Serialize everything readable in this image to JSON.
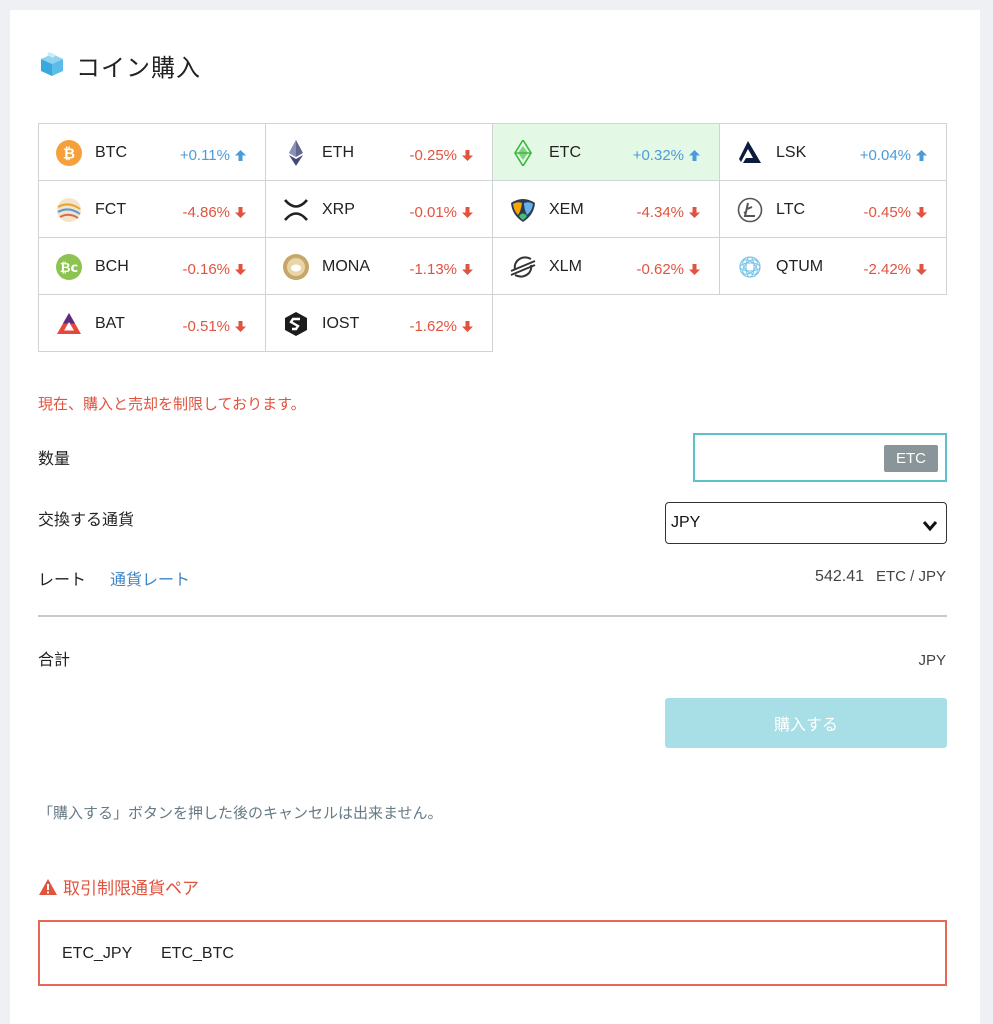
{
  "header": {
    "title": "コイン購入",
    "icon": "cube-icon"
  },
  "coins": [
    {
      "symbol": "BTC",
      "change": "+0.11%",
      "dir": "up",
      "icon": "bitcoin-icon"
    },
    {
      "symbol": "ETH",
      "change": "-0.25%",
      "dir": "down",
      "icon": "ethereum-icon"
    },
    {
      "symbol": "ETC",
      "change": "+0.32%",
      "dir": "up",
      "icon": "ethereum-classic-icon",
      "selected": true
    },
    {
      "symbol": "LSK",
      "change": "+0.04%",
      "dir": "up",
      "icon": "lisk-icon"
    },
    {
      "symbol": "FCT",
      "change": "-4.86%",
      "dir": "down",
      "icon": "factom-icon"
    },
    {
      "symbol": "XRP",
      "change": "-0.01%",
      "dir": "down",
      "icon": "ripple-icon"
    },
    {
      "symbol": "XEM",
      "change": "-4.34%",
      "dir": "down",
      "icon": "nem-icon"
    },
    {
      "symbol": "LTC",
      "change": "-0.45%",
      "dir": "down",
      "icon": "litecoin-icon"
    },
    {
      "symbol": "BCH",
      "change": "-0.16%",
      "dir": "down",
      "icon": "bitcoin-cash-icon"
    },
    {
      "symbol": "MONA",
      "change": "-1.13%",
      "dir": "down",
      "icon": "monacoin-icon"
    },
    {
      "symbol": "XLM",
      "change": "-0.62%",
      "dir": "down",
      "icon": "stellar-icon"
    },
    {
      "symbol": "QTUM",
      "change": "-2.42%",
      "dir": "down",
      "icon": "qtum-icon"
    },
    {
      "symbol": "BAT",
      "change": "-0.51%",
      "dir": "down",
      "icon": "bat-icon"
    },
    {
      "symbol": "IOST",
      "change": "-1.62%",
      "dir": "down",
      "icon": "iost-icon"
    }
  ],
  "notice": "現在、購入と売却を制限しております。",
  "form": {
    "quantity_label": "数量",
    "quantity_value": "",
    "quantity_unit": "ETC",
    "exchange_label": "交換する通貨",
    "exchange_value": "JPY",
    "rate_label": "レート",
    "rate_link": "通貨レート",
    "rate_value": "542.41",
    "rate_unit": "ETC / JPY",
    "total_label": "合計",
    "total_unit": "JPY",
    "buy_button": "購入する"
  },
  "cancel_note": "「購入する」ボタンを押した後のキャンセルは出来ません。",
  "restriction": {
    "title": "取引制限通貨ペア",
    "pairs": [
      "ETC_JPY",
      "ETC_BTC"
    ]
  },
  "colors": {
    "up": "#4a9bd8",
    "down": "#e0533f",
    "accent": "#5cc2c8",
    "buy_button": "#a8dfe7",
    "selected_cell": "#e4f8e6",
    "warning": "#e0533f"
  }
}
